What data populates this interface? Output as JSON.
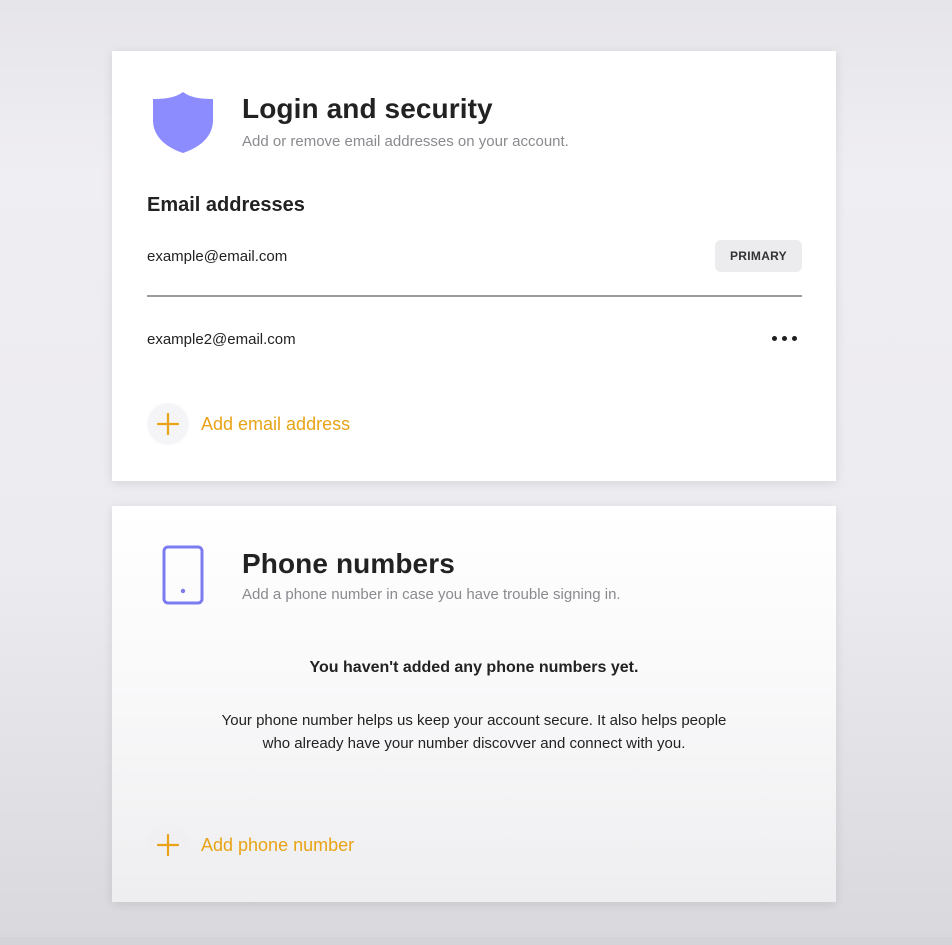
{
  "login_security": {
    "title": "Login and security",
    "subtitle": "Add or remove email addresses on your account.",
    "icon": "shield-icon",
    "section_heading": "Email addresses",
    "emails": [
      {
        "address": "example@email.com",
        "badge": "PRIMARY"
      },
      {
        "address": "example2@email.com",
        "action": "more-options-icon"
      }
    ],
    "add_label": "Add email address"
  },
  "phone_numbers": {
    "title": "Phone numbers",
    "subtitle": "Add a phone number in case you have trouble signing in.",
    "icon": "phone-icon",
    "empty_title": "You haven't added any phone numbers yet.",
    "empty_description": "Your phone number helps us keep your account secure. It also helps people who already have your number discovver and connect with you.",
    "add_label": "Add phone number"
  },
  "colors": {
    "accent": "#e8a316",
    "icon_fill": "#8c8cff",
    "icon_stroke": "#7c7cf0",
    "badge_bg": "#ececee"
  }
}
